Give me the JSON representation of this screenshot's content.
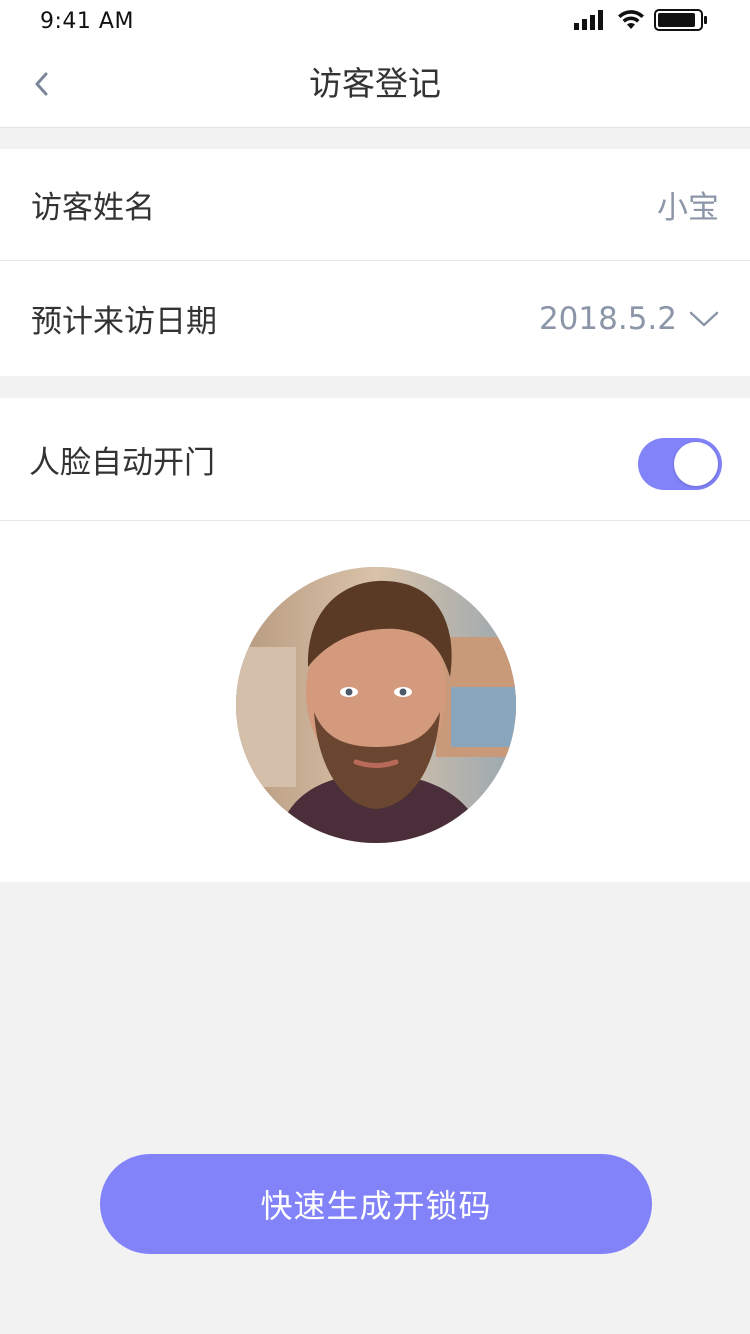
{
  "status_bar": {
    "time": "9:41 AM",
    "icons": [
      "signal-icon",
      "wifi-icon",
      "battery-icon"
    ]
  },
  "nav": {
    "title": "访客登记",
    "back_icon": "chevron-left-icon"
  },
  "form": {
    "visitor_name_label": "访客姓名",
    "visitor_name_value": "小宝",
    "visit_date_label": "预计来访日期",
    "visit_date_value": "2018.5.2",
    "visit_date_icon": "chevron-down-icon",
    "face_unlock_label": "人脸自动开门",
    "face_unlock_enabled": true
  },
  "submit_label": "快速生成开锁码",
  "colors": {
    "accent": "#8283f8",
    "value_text": "#8c96a8",
    "background": "#f2f2f2"
  }
}
